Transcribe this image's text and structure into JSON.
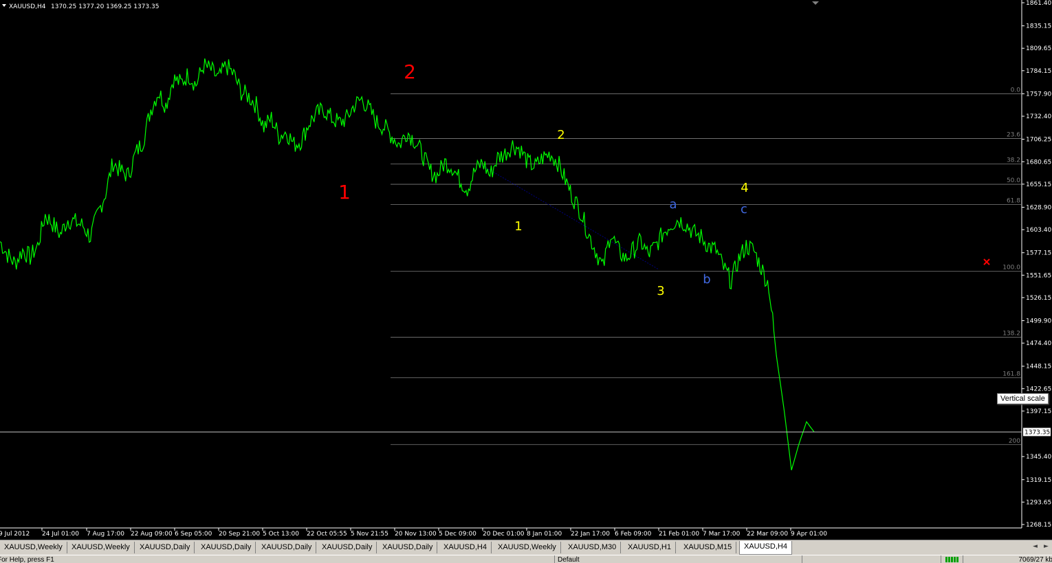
{
  "header": {
    "symbol": "XAUUSD,H4",
    "ohlc": "1370.25 1377.20 1369.25 1373.35"
  },
  "colors": {
    "background": "#000000",
    "price_line": "#00ff00",
    "fib_line": "#808080",
    "wave_red": "#ff0000",
    "wave_yellow": "#ffff00",
    "wave_blue": "#4169e1",
    "axis_text": "#ffffff"
  },
  "icons": {
    "dropdown": "triangle-down-icon",
    "close_marker": "red-x-icon",
    "scroll_left": "arrow-left-icon",
    "scroll_right": "arrow-right-icon"
  },
  "tooltip": {
    "vertical_scale": "Vertical scale"
  },
  "tabs": [
    {
      "label": "XAUUSD,Weekly",
      "active": false
    },
    {
      "label": "XAUUSD,Weekly",
      "active": false
    },
    {
      "label": "XAUUSD,Daily",
      "active": false
    },
    {
      "label": "XAUUSD,Daily",
      "active": false
    },
    {
      "label": "XAUUSD,Daily",
      "active": false
    },
    {
      "label": "XAUUSD,Daily",
      "active": false
    },
    {
      "label": "XAUUSD,Daily",
      "active": false
    },
    {
      "label": "XAUUSD,H4",
      "active": false
    },
    {
      "label": "XAUUSD,Weekly",
      "active": false
    },
    {
      "label": "XAUUSD,M30",
      "active": false
    },
    {
      "label": "XAUUSD,H1",
      "active": false
    },
    {
      "label": "XAUUSD,M15",
      "active": false
    },
    {
      "label": "XAUUSD,H4",
      "active": true
    }
  ],
  "status": {
    "help": "For Help, press F1",
    "profile": "Default",
    "traffic": "7069/27 kb"
  },
  "chart_data": {
    "type": "line",
    "title": "XAUUSD,H4",
    "x_tick_labels": [
      "9 Jul 2012",
      "24 Jul 01:00",
      "7 Aug 17:00",
      "22 Aug 09:00",
      "6 Sep 05:00",
      "20 Sep 21:00",
      "5 Oct 13:00",
      "22 Oct 05:55",
      "5 Nov 21:55",
      "20 Nov 13:00",
      "5 Dec 09:00",
      "20 Dec 01:00",
      "8 Jan 01:00",
      "22 Jan 17:00",
      "6 Feb 09:00",
      "21 Feb 01:00",
      "7 Mar 17:00",
      "22 Mar 09:00",
      "9 Apr 01:00"
    ],
    "y_tick_labels": [
      "1861.40",
      "1835.15",
      "1809.65",
      "1784.15",
      "1757.90",
      "1732.40",
      "1706.25",
      "1680.65",
      "1655.15",
      "1628.90",
      "1603.40",
      "1577.15",
      "1551.65",
      "1526.15",
      "1499.90",
      "1474.40",
      "1448.15",
      "1422.65",
      "1397.15",
      "1345.40",
      "1319.15",
      "1293.65",
      "1268.15"
    ],
    "ylim": [
      1268.15,
      1861.4
    ],
    "current_price": "1373.35",
    "series": [
      {
        "values": [
          1590,
          1575,
          1565,
          1580,
          1572,
          1585,
          1620,
          1610,
          1598,
          1615,
          1612,
          1608,
          1595,
          1622,
          1645,
          1680,
          1670,
          1665,
          1690,
          1705,
          1740,
          1760,
          1745,
          1775,
          1770,
          1780,
          1768,
          1790,
          1785,
          1775,
          1790,
          1780,
          1760,
          1755,
          1745,
          1720,
          1730,
          1710,
          1715,
          1700,
          1705,
          1725,
          1735,
          1740,
          1730,
          1725,
          1730,
          1745,
          1752,
          1740,
          1725,
          1720,
          1710,
          1700,
          1715,
          1705,
          1690,
          1670,
          1665,
          1680,
          1675,
          1660,
          1650,
          1670,
          1680,
          1665,
          1685,
          1690,
          1700,
          1695,
          1680,
          1675,
          1685,
          1690,
          1680,
          1660,
          1640,
          1625,
          1600,
          1580,
          1560,
          1600,
          1580,
          1570,
          1580,
          1590,
          1575,
          1585,
          1600,
          1610,
          1615,
          1610,
          1600,
          1595,
          1585,
          1580,
          1560,
          1545,
          1570,
          1585,
          1580,
          1560,
          1540,
          1460,
          1400,
          1330,
          1360,
          1385,
          1373.35
        ]
      }
    ],
    "fibonacci_levels": [
      {
        "label": "0.0",
        "price": 1758
      },
      {
        "label": "23.6",
        "price": 1707
      },
      {
        "label": "38.2",
        "price": 1678
      },
      {
        "label": "50.0",
        "price": 1655
      },
      {
        "label": "61.8",
        "price": 1632
      },
      {
        "label": "100.0",
        "price": 1556
      },
      {
        "label": "138.2",
        "price": 1481
      },
      {
        "label": "161.8",
        "price": 1435
      },
      {
        "label": "200",
        "price": 1359
      }
    ],
    "annotations": [
      {
        "text": "2",
        "group": "red",
        "big": true
      },
      {
        "text": "1",
        "group": "red",
        "big": true
      },
      {
        "text": "1",
        "group": "yellow"
      },
      {
        "text": "2",
        "group": "yellow"
      },
      {
        "text": "3",
        "group": "yellow"
      },
      {
        "text": "4",
        "group": "yellow"
      },
      {
        "text": "a",
        "group": "blue"
      },
      {
        "text": "b",
        "group": "blue"
      },
      {
        "text": "c",
        "group": "blue"
      }
    ]
  }
}
